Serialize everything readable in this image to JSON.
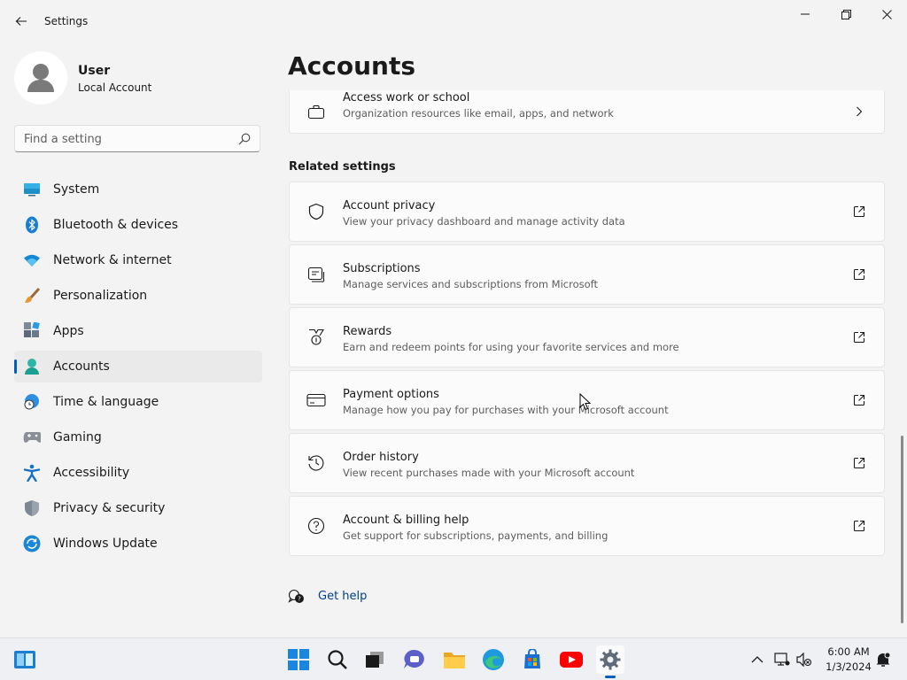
{
  "window": {
    "title": "Settings"
  },
  "profile": {
    "name": "User",
    "account_type": "Local Account"
  },
  "search": {
    "placeholder": "Find a setting",
    "value": ""
  },
  "nav": {
    "items": [
      {
        "label": "System",
        "icon": "monitor-icon"
      },
      {
        "label": "Bluetooth & devices",
        "icon": "bluetooth-icon"
      },
      {
        "label": "Network & internet",
        "icon": "wifi-icon"
      },
      {
        "label": "Personalization",
        "icon": "brush-icon"
      },
      {
        "label": "Apps",
        "icon": "apps-icon"
      },
      {
        "label": "Accounts",
        "icon": "person-icon",
        "active": true
      },
      {
        "label": "Time & language",
        "icon": "globe-clock-icon"
      },
      {
        "label": "Gaming",
        "icon": "gamepad-icon"
      },
      {
        "label": "Accessibility",
        "icon": "accessibility-icon"
      },
      {
        "label": "Privacy & security",
        "icon": "shield-icon"
      },
      {
        "label": "Windows Update",
        "icon": "update-icon"
      }
    ]
  },
  "main": {
    "title": "Accounts",
    "top_card": {
      "title": "Access work or school",
      "subtitle": "Organization resources like email, apps, and network",
      "icon": "briefcase-icon"
    },
    "related_heading": "Related settings",
    "related": [
      {
        "title": "Account privacy",
        "subtitle": "View your privacy dashboard and manage activity data",
        "icon": "shield-outline-icon"
      },
      {
        "title": "Subscriptions",
        "subtitle": "Manage services and subscriptions from Microsoft",
        "icon": "subscriptions-icon"
      },
      {
        "title": "Rewards",
        "subtitle": "Earn and redeem points for using your favorite services and more",
        "icon": "medal-icon"
      },
      {
        "title": "Payment options",
        "subtitle": "Manage how you pay for purchases with your Microsoft account",
        "icon": "credit-card-icon"
      },
      {
        "title": "Order history",
        "subtitle": "View recent purchases made with your Microsoft account",
        "icon": "history-icon"
      },
      {
        "title": "Account & billing help",
        "subtitle": "Get support for subscriptions, payments, and billing",
        "icon": "question-icon"
      }
    ],
    "help_link": "Get help"
  },
  "taskbar": {
    "clock_time": "6:00 AM",
    "clock_date": "1/3/2024"
  },
  "colors": {
    "accent": "#005fb8",
    "link": "#003e92"
  }
}
